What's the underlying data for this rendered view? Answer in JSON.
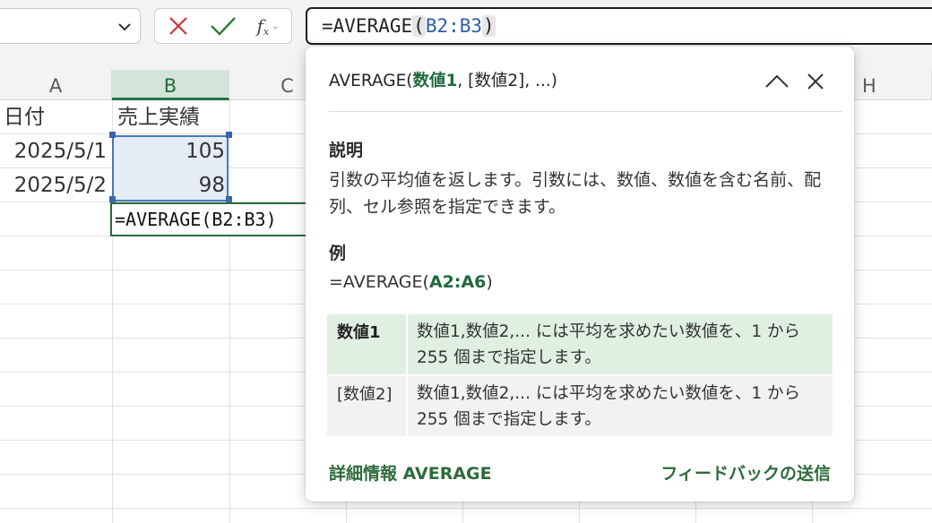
{
  "formula_bar": {
    "formula_prefix": "=AVERAGE",
    "open_paren": "(",
    "range_ref": "B2:B3",
    "close_paren": ")",
    "fx_label": "f",
    "fx_sub": "x",
    "cancel_icon": "close-icon",
    "confirm_icon": "check-icon"
  },
  "columns": [
    {
      "label": "A",
      "selected": false
    },
    {
      "label": "B",
      "selected": true
    },
    {
      "label": "C",
      "selected": false
    },
    {
      "label": "H",
      "selected": false
    }
  ],
  "cells": {
    "a1": "日付",
    "b1": "売上実績",
    "a2": "2025/5/1",
    "b2": "105",
    "a3": "2025/5/2",
    "b3": "98",
    "b4": "=AVERAGE(B2:B3)"
  },
  "tooltip": {
    "sig_name": "AVERAGE(",
    "sig_arg1": "数値1",
    "sig_rest": ", [数値2], ...)",
    "heading_description": "説明",
    "description": "引数の平均値を返します。引数には、数値、数値を含む名前、配列、セル参照を指定できます。",
    "heading_example": "例",
    "example_prefix": "=AVERAGE(",
    "example_range": "A2:A6",
    "example_suffix": ")",
    "args": [
      {
        "name": "数値1",
        "desc": "数値1,数値2,... には平均を求めたい数値を、1 から 255 個まで指定します。",
        "active": true
      },
      {
        "name": "[数値2]",
        "desc": "数値1,数値2,... には平均を求めたい数値を、1 から 255 個まで指定します。",
        "active": false
      }
    ],
    "link_more_info": "詳細情報 AVERAGE",
    "link_feedback": "フィードバックの送信"
  },
  "colors": {
    "accent_green": "#217346",
    "link_green": "#2e6b3c",
    "range_blue": "#4a76b8",
    "active_arg_bg": "#dff0e2"
  }
}
